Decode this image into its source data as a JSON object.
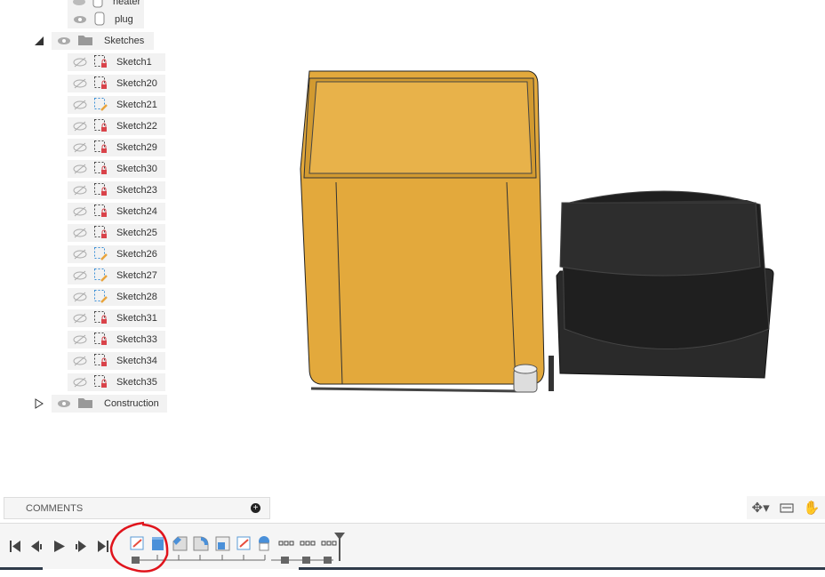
{
  "browser": {
    "bodies": [
      {
        "label": "heater"
      },
      {
        "label": "plug"
      }
    ],
    "sketches_folder": "Sketches",
    "sketches": [
      {
        "label": "Sketch1",
        "state": "locked"
      },
      {
        "label": "Sketch20",
        "state": "locked"
      },
      {
        "label": "Sketch21",
        "state": "editable"
      },
      {
        "label": "Sketch22",
        "state": "locked"
      },
      {
        "label": "Sketch29",
        "state": "locked"
      },
      {
        "label": "Sketch30",
        "state": "locked"
      },
      {
        "label": "Sketch23",
        "state": "locked"
      },
      {
        "label": "Sketch24",
        "state": "locked"
      },
      {
        "label": "Sketch25",
        "state": "locked"
      },
      {
        "label": "Sketch26",
        "state": "editable"
      },
      {
        "label": "Sketch27",
        "state": "editable"
      },
      {
        "label": "Sketch28",
        "state": "editable"
      },
      {
        "label": "Sketch31",
        "state": "locked"
      },
      {
        "label": "Sketch33",
        "state": "locked"
      },
      {
        "label": "Sketch34",
        "state": "locked"
      },
      {
        "label": "Sketch35",
        "state": "locked"
      }
    ],
    "construction_folder": "Construction"
  },
  "comments": {
    "label": "COMMENTS"
  },
  "colors": {
    "body_yellow": "#e3a93c",
    "body_black": "#2a2a2a",
    "annotation": "#e0141c",
    "lock": "#d9434a"
  }
}
